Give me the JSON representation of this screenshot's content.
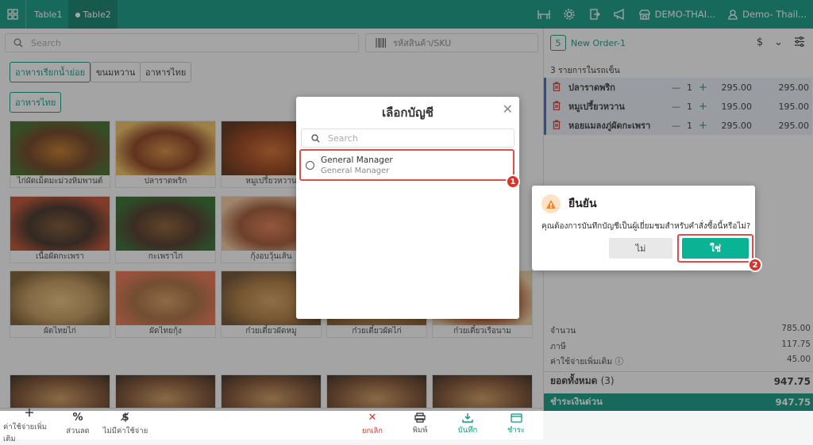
{
  "topbar": {
    "tabs": [
      {
        "label": "Table1"
      },
      {
        "label": "Table2",
        "dot": "●"
      }
    ],
    "store_name": "DEMO-THAI...",
    "user_name": "Demo- Thail..."
  },
  "search": {
    "placeholder": "Search"
  },
  "sku": {
    "placeholder": "รหัสสินค้า/SKU"
  },
  "categories": [
    "อาหารเรียกน้ำย่อย",
    "ขนมหวาน",
    "อาหารไทย",
    "อาหารไทย"
  ],
  "menu_items": [
    "ไก่ผัดเม็ดมะม่วงหิมพานต์",
    "ปลาราดพริก",
    "หมูเปรี้ยวหวาน",
    "",
    "เนื้อผัดกะเพรา",
    "กะเพราไก่",
    "กุ้งอบวุ้นเส้น",
    "",
    "ผัดไทยไก่",
    "ผัดไทยกุ้ง",
    "ก๋วยเตี๋ยวผัดหมู",
    "ก๋วยเตี๋ยวผัดไก่",
    "ก๋วยเตี๋ยวเรือนาม"
  ],
  "bottom": {
    "extra_fee": "ค่าใช้จ่ายเพิ่มเติม",
    "discount": "ส่วนลด",
    "no_fee": "ไม่มีค่าใช้จ่าย",
    "cancel": "ยกเลิก",
    "print": "พิมพ์",
    "save": "บันทึก",
    "pay": "ชำระ"
  },
  "order": {
    "table_no": "5",
    "name": "New Order-1",
    "items_count": "3 รายการในรถเข็น",
    "items": [
      {
        "name": "ปลาราดพริก",
        "qty": "1",
        "price": "295.00",
        "total": "295.00"
      },
      {
        "name": "หมูเปรี้ยวหวาน",
        "qty": "1",
        "price": "195.00",
        "total": "195.00"
      },
      {
        "name": "หอยแมลงภู่ผัดกะเพรา",
        "qty": "1",
        "price": "295.00",
        "total": "295.00"
      }
    ],
    "summary": [
      {
        "label": "จำนวน",
        "value": "785.00"
      },
      {
        "label": "ภาษี",
        "value": "117.75"
      },
      {
        "label": "ค่าใช้จ่ายเพิ่มเติม ⓘ",
        "value": "45.00"
      }
    ],
    "grand_label": "ยอดทั้งหมด",
    "grand_count": "(3)",
    "grand_value": "947.75",
    "pay_label": "ชำระเงินด่วน",
    "pay_value": "947.75"
  },
  "account_dialog": {
    "title": "เลือกบัญชี",
    "search_placeholder": "Search",
    "account_name": "General Manager",
    "account_role": "General Manager",
    "marker": "1"
  },
  "confirm_dialog": {
    "title": "ยืนยัน",
    "message": "คุณต้องการบันทึกบัญชีเป็นผู้เยี่ยมชมสำหรับคำสั่งซื้อนี้หรือไม่?",
    "no_label": "ไม่",
    "yes_label": "ใช่",
    "marker": "2"
  },
  "colors": {
    "accent": "#0b9a80",
    "danger": "#d9342b",
    "item_bg": "#eaf0f7"
  }
}
